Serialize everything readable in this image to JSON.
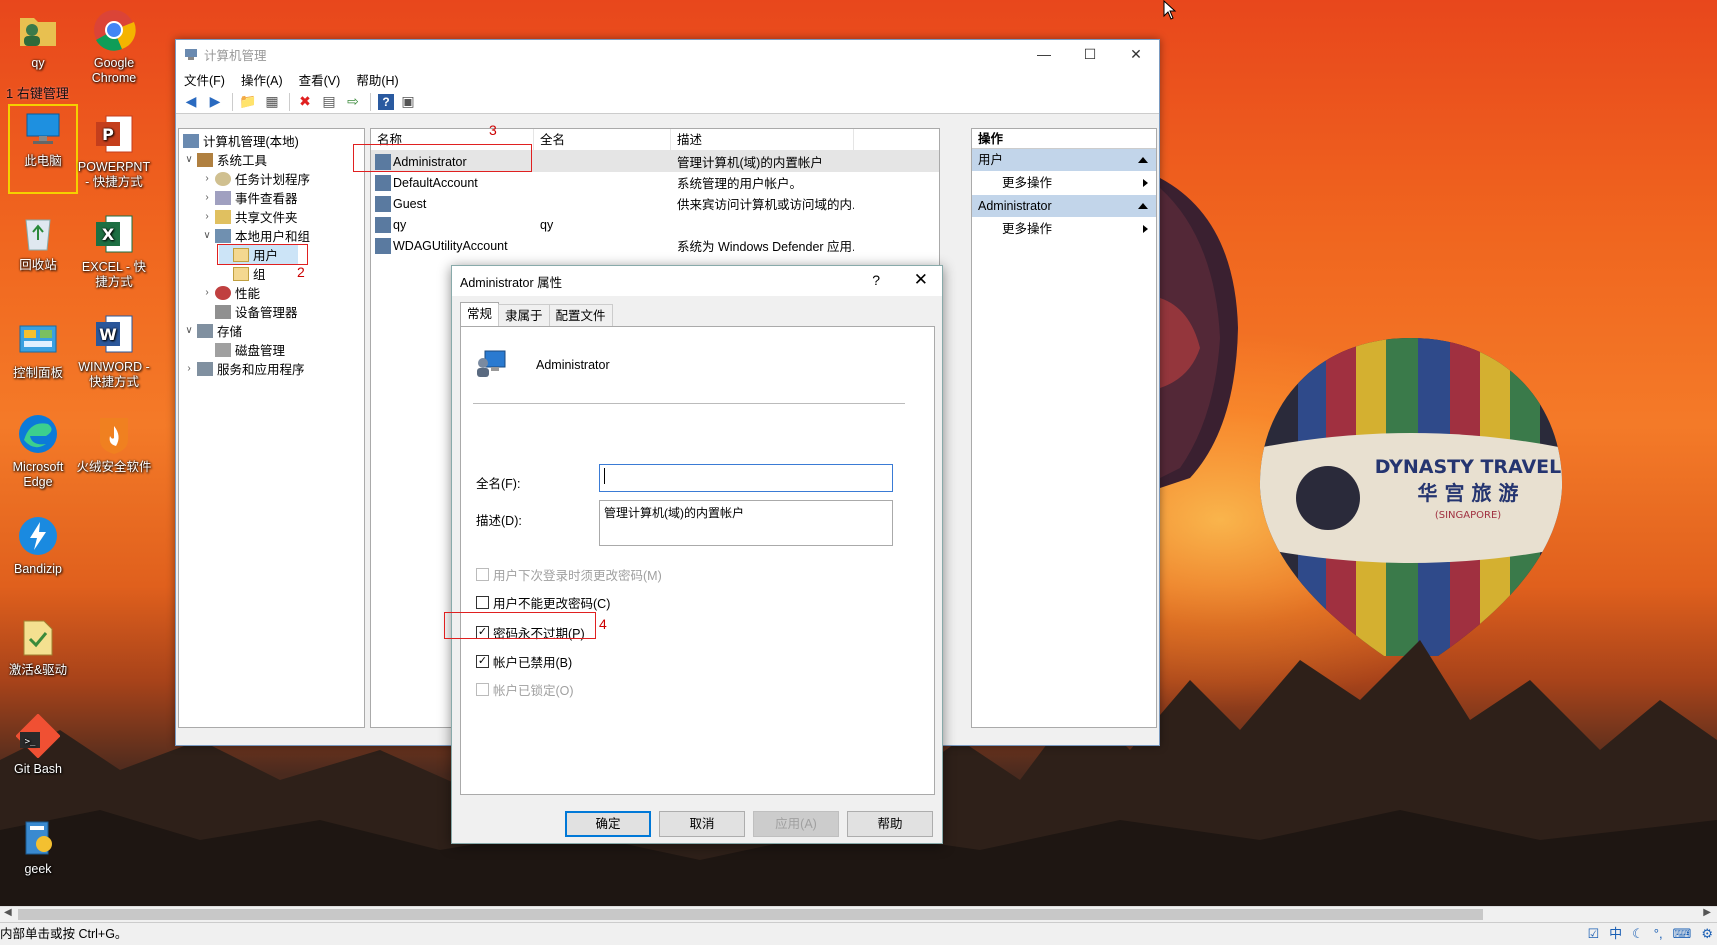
{
  "desktop": {
    "icons": [
      {
        "label": "qy",
        "icon": "user-folder-icon"
      },
      {
        "label": "Google Chrome",
        "icon": "chrome-icon"
      },
      {
        "label": "此电脑",
        "icon": "computer-icon"
      },
      {
        "label": "POWERPNT - 快捷方式",
        "icon": "powerpoint-icon"
      },
      {
        "label": "回收站",
        "icon": "recycle-bin-icon"
      },
      {
        "label": "EXCEL - 快捷方式",
        "icon": "excel-icon"
      },
      {
        "label": "控制面板",
        "icon": "control-panel-icon"
      },
      {
        "label": "WINWORD - 快捷方式",
        "icon": "word-icon"
      },
      {
        "label": "Microsoft Edge",
        "icon": "edge-icon"
      },
      {
        "label": "火绒安全软件",
        "icon": "huorong-icon"
      },
      {
        "label": "Bandizip",
        "icon": "bandizip-icon"
      },
      {
        "label": "激活&驱动",
        "icon": "activation-icon"
      },
      {
        "label": "Git Bash",
        "icon": "git-bash-icon"
      },
      {
        "label": "geek",
        "icon": "geek-icon"
      }
    ],
    "note_step1": "1 右键管理",
    "balloon_text_1": "DYNASTY TRAVEL",
    "balloon_text_2": "华 宫 旅 游",
    "balloon_text_3": "(SINGAPORE)"
  },
  "window": {
    "title": "计算机管理",
    "menu": [
      "文件(F)",
      "操作(A)",
      "查看(V)",
      "帮助(H)"
    ],
    "tree": {
      "root": "计算机管理(本地)",
      "system_tools": "系统工具",
      "task_scheduler": "任务计划程序",
      "event_viewer": "事件查看器",
      "shared_folders": "共享文件夹",
      "local_users": "本地用户和组",
      "users": "用户",
      "groups": "组",
      "performance": "性能",
      "device_manager": "设备管理器",
      "storage": "存储",
      "disk_management": "磁盘管理",
      "services": "服务和应用程序"
    },
    "columns": [
      "名称",
      "全名",
      "描述"
    ],
    "users": [
      {
        "name": "Administrator",
        "fullname": "",
        "desc": "管理计算机(域)的内置帐户"
      },
      {
        "name": "DefaultAccount",
        "fullname": "",
        "desc": "系统管理的用户帐户。"
      },
      {
        "name": "Guest",
        "fullname": "",
        "desc": "供来宾访问计算机或访问域的内..."
      },
      {
        "name": "qy",
        "fullname": "qy",
        "desc": ""
      },
      {
        "name": "WDAGUtilityAccount",
        "fullname": "",
        "desc": "系统为 Windows Defender 应用..."
      }
    ],
    "actions": {
      "title": "操作",
      "section1": "用户",
      "section2": "Administrator",
      "more": "更多操作"
    },
    "notes": {
      "step2": "2",
      "step3": "3",
      "step4": "4"
    }
  },
  "dialog": {
    "title": "Administrator 属性",
    "help": "?",
    "close": "✕",
    "tabs": [
      "常规",
      "隶属于",
      "配置文件"
    ],
    "username": "Administrator",
    "fullname_label": "全名(F):",
    "fullname_value": "",
    "desc_label": "描述(D):",
    "desc_value": "管理计算机(域)的内置帐户",
    "checks": [
      {
        "label": "用户下次登录时须更改密码(M)",
        "checked": false,
        "disabled": true
      },
      {
        "label": "用户不能更改密码(C)",
        "checked": false,
        "disabled": false
      },
      {
        "label": "密码永不过期(P)",
        "checked": true,
        "disabled": false
      },
      {
        "label": "帐户已禁用(B)",
        "checked": true,
        "disabled": false
      },
      {
        "label": "帐户已锁定(O)",
        "checked": false,
        "disabled": true
      }
    ],
    "buttons": {
      "ok": "确定",
      "cancel": "取消",
      "apply": "应用(A)",
      "help": "帮助"
    }
  },
  "statusbar": {
    "text": "内部单击或按 Ctrl+G。",
    "ime": "中"
  }
}
